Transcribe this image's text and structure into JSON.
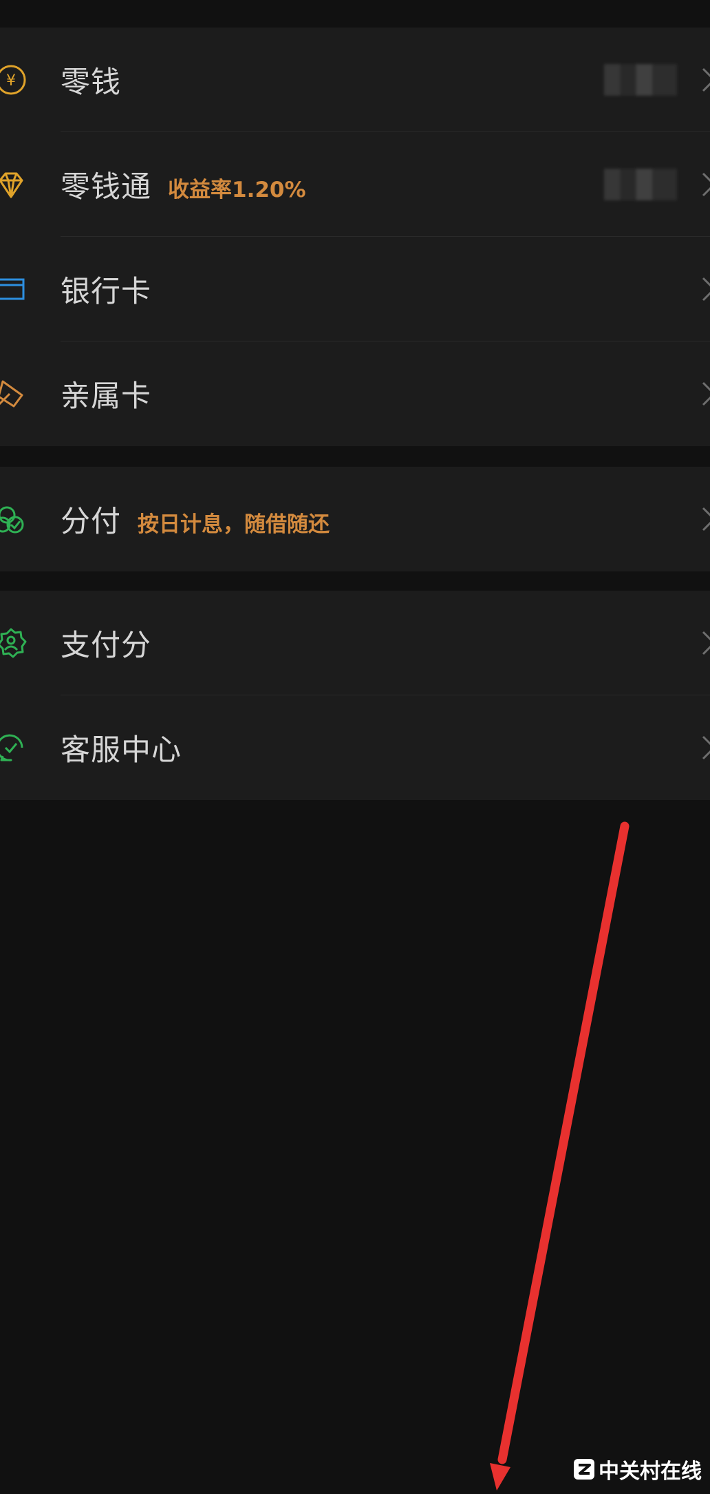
{
  "group1": {
    "items": [
      {
        "label": "零钱",
        "icon": "yuan-coin-icon",
        "value_masked": true
      },
      {
        "label": "零钱通",
        "sub": "收益率1.20%",
        "icon": "diamond-icon",
        "value_masked": true
      },
      {
        "label": "银行卡",
        "icon": "bank-card-icon"
      },
      {
        "label": "亲属卡",
        "icon": "family-card-icon"
      }
    ]
  },
  "group2": {
    "items": [
      {
        "label": "分付",
        "sub": "按日计息，随借随还",
        "icon": "fenfu-icon"
      }
    ]
  },
  "group3": {
    "items": [
      {
        "label": "支付分",
        "icon": "payment-score-icon"
      },
      {
        "label": "客服中心",
        "icon": "customer-service-icon"
      }
    ]
  },
  "watermark": {
    "text": "中关村在线"
  },
  "colors": {
    "accent_orange": "#d38a3e",
    "gold": "#e0a32a",
    "blue": "#2d8fe0",
    "green": "#2fb154",
    "arrow_red": "#e8312f"
  }
}
